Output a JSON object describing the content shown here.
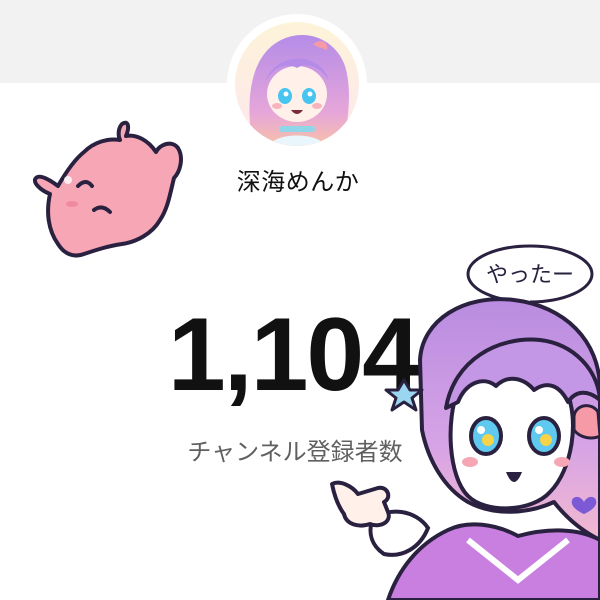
{
  "channel": {
    "name": "深海めんか"
  },
  "subscribers": {
    "count": "1,104",
    "label": "チャンネル登録者数"
  },
  "illustration": {
    "speech_bubble": "やったー"
  },
  "colors": {
    "top_band": "#f2f2f2",
    "count_text": "#111111",
    "label_text": "#606060",
    "mendako_pink": "#f7a6b6",
    "hair_purple": "#c79ae8"
  }
}
